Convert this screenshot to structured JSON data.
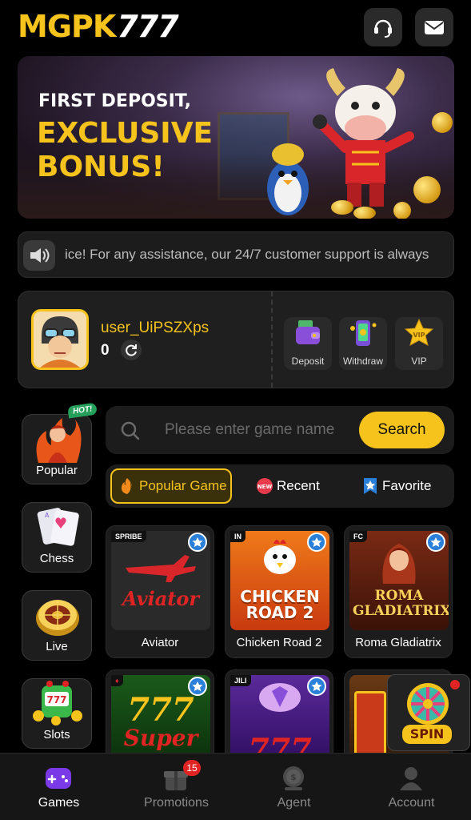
{
  "header": {
    "logo_left": "MGPK",
    "logo_right": "777",
    "support_icon": "headset-icon",
    "mail_icon": "mail-icon"
  },
  "banner": {
    "line1": "FIRST DEPOSIT,",
    "line2": "EXCLUSIVE",
    "line3": "BONUS!"
  },
  "marquee": {
    "text": "ice! For any assistance, our 24/7 customer support is always",
    "icon": "speaker-icon"
  },
  "user": {
    "username": "user_UiPSZXps",
    "balance": "0",
    "actions": [
      {
        "label": "Deposit",
        "icon": "wallet-icon"
      },
      {
        "label": "Withdraw",
        "icon": "phone-cash-icon"
      },
      {
        "label": "VIP",
        "icon": "vip-star-icon"
      }
    ]
  },
  "categories": [
    {
      "label": "Popular",
      "badge": "HOT!"
    },
    {
      "label": "Chess"
    },
    {
      "label": "Live"
    },
    {
      "label": "Slots"
    }
  ],
  "search": {
    "placeholder": "Please enter game name",
    "button": "Search"
  },
  "tabs": [
    {
      "label": "Popular Game",
      "active": true
    },
    {
      "label": "Recent",
      "badge": "NEW"
    },
    {
      "label": "Favorite"
    }
  ],
  "games": [
    {
      "name": "Aviator",
      "provider": "SPRIBE",
      "art": "Aviator"
    },
    {
      "name": "Chicken Road 2",
      "provider": "IN",
      "art": "CHICKEN ROAD 2"
    },
    {
      "name": "Roma Gladiatrix",
      "provider": "FC",
      "art": "ROMA GLADIATRIX"
    },
    {
      "name": "",
      "provider": "",
      "art": "Super"
    },
    {
      "name": "",
      "provider": "JILI",
      "art": "777"
    },
    {
      "name": "",
      "provider": "",
      "art": ""
    }
  ],
  "spin": {
    "label": "SPIN"
  },
  "nav": [
    {
      "label": "Games",
      "active": true
    },
    {
      "label": "Promotions",
      "badge": "15"
    },
    {
      "label": "Agent"
    },
    {
      "label": "Account"
    }
  ],
  "colors": {
    "accent": "#f6c31c",
    "background": "#000000",
    "card": "#1c1c1c",
    "badge": "#e02424",
    "fav": "#2a7fd8"
  }
}
